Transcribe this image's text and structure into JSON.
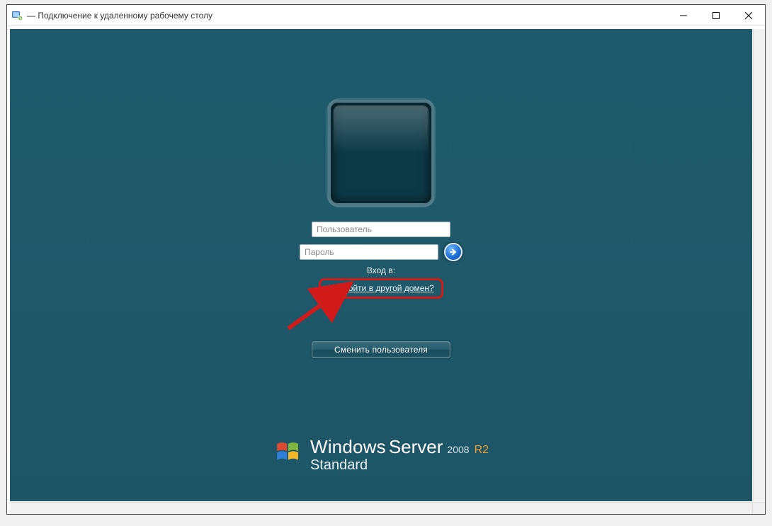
{
  "window": {
    "title": " — Подключение к удаленному рабочему столу"
  },
  "login": {
    "username_placeholder": "Пользователь",
    "password_placeholder": "Пароль",
    "login_to_label": "Вход в:",
    "domain_link": "Как войти в другой домен?",
    "switch_user_label": "Сменить пользователя"
  },
  "branding": {
    "windows": "Windows",
    "server": "Server",
    "year": "2008",
    "r2": "R2",
    "edition": "Standard"
  }
}
